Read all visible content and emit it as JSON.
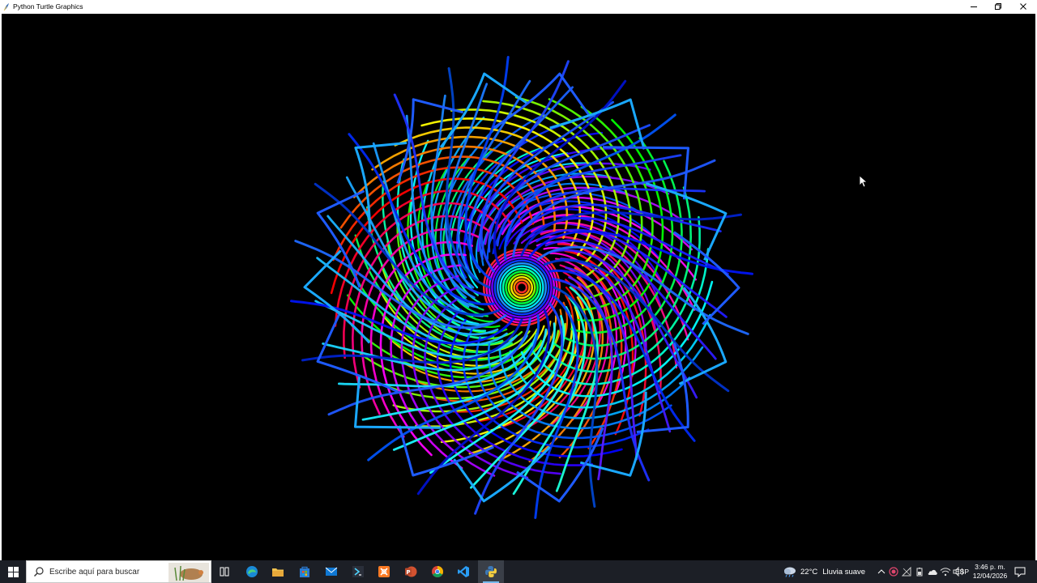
{
  "window": {
    "title": "Python Turtle Graphics",
    "icon": "python-feather-icon",
    "controls": [
      "minimize-icon",
      "maximize-icon",
      "close-icon"
    ]
  },
  "canvas": {
    "background": "#000000",
    "drawing": "rainbow spirograph"
  },
  "taskbar": {
    "background": "#1c1f26",
    "start_icon": "windows-logo-icon",
    "search_placeholder": "Escribe aquí para buscar",
    "pinned": [
      {
        "name": "task-view-icon"
      },
      {
        "name": "edge-icon"
      },
      {
        "name": "file-explorer-icon"
      },
      {
        "name": "store-icon"
      },
      {
        "name": "mail-icon"
      },
      {
        "name": "powershell-icon"
      },
      {
        "name": "xampp-icon"
      },
      {
        "name": "powerpoint-icon"
      },
      {
        "name": "chrome-icon"
      },
      {
        "name": "vscode-icon"
      },
      {
        "name": "python-icon",
        "active": true
      }
    ],
    "weather": {
      "icon": "cloud-rain-icon",
      "temp": "22°C",
      "desc": "Lluvia suave"
    },
    "tray": [
      "chevron-up-icon",
      "record-icon",
      "network-icon",
      "battery-icon",
      "cloud-icon",
      "wifi-icon",
      "volume-icon"
    ],
    "language": "ESP",
    "clock": {
      "time": "3:46 p. m.",
      "date": "12/04/2026"
    },
    "notification_icon": "notification-icon"
  }
}
